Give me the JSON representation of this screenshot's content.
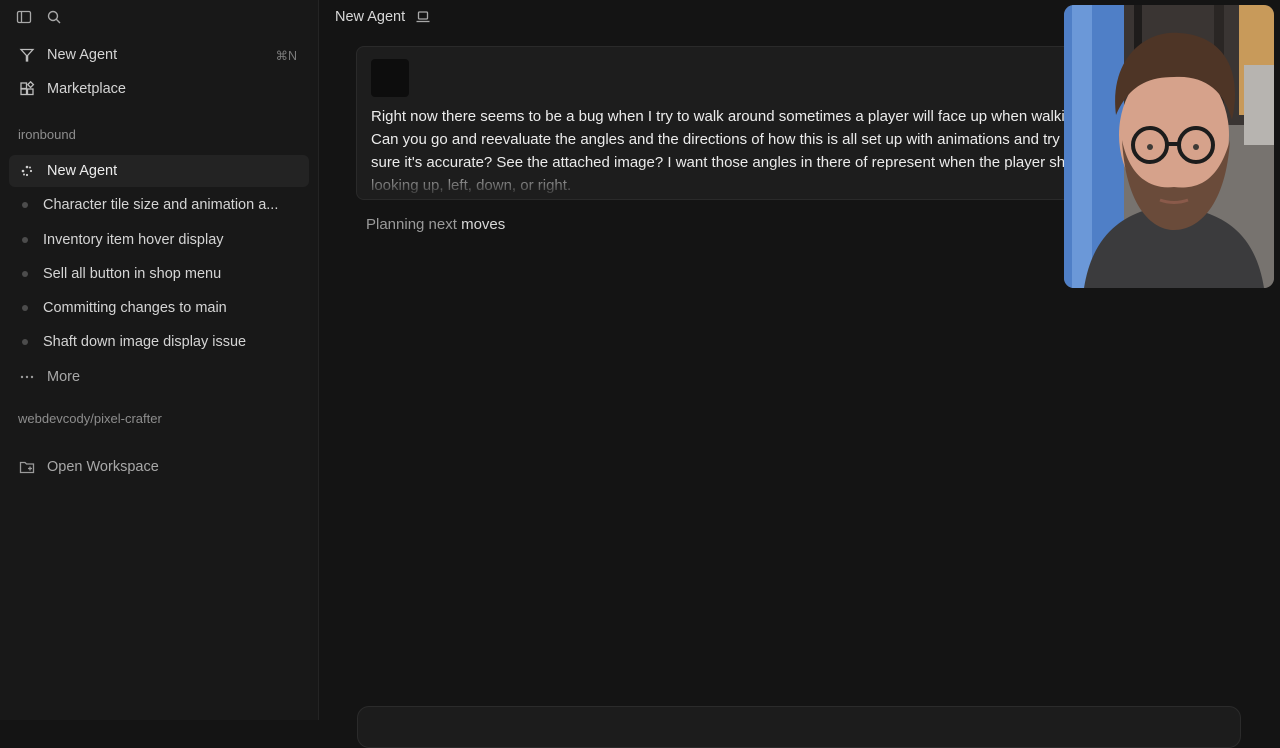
{
  "sidebar": {
    "top_icons": [
      "sidebar-toggle-icon",
      "search-icon"
    ],
    "nav": [
      {
        "label": "New Agent",
        "icon": "agent-icon",
        "shortcut": "⌘N"
      },
      {
        "label": "Marketplace",
        "icon": "marketplace-icon"
      }
    ],
    "workspace_1": {
      "name": "ironbound",
      "items": [
        {
          "label": "New Agent",
          "active": true
        },
        {
          "label": "Character tile size and animation a..."
        },
        {
          "label": "Inventory item hover display"
        },
        {
          "label": "Sell all button in shop menu"
        },
        {
          "label": "Committing changes to main"
        },
        {
          "label": "Shaft down image display issue"
        }
      ],
      "more_label": "More"
    },
    "workspace_2": {
      "name": "webdevcody/pixel-crafter"
    },
    "open_workspace_label": "Open Workspace"
  },
  "header": {
    "title": "New Agent",
    "icon": "laptop-icon"
  },
  "message": {
    "text": "Right now there seems to be a bug when I try to walk around sometimes a player will face up when walking down. Can you go and reevaluate the angles and the directions of how this is all set up with animations and try to make sure it's accurate? See the attached image? I want those angles in there of represent when the player should be looking up, left, down, or right."
  },
  "status": {
    "prefix": "Planning next",
    "emphasis": "moves"
  },
  "colors": {
    "background": "#141414",
    "sidebar": "#181818",
    "card": "#1d1d1d",
    "active_row": "#232323"
  }
}
